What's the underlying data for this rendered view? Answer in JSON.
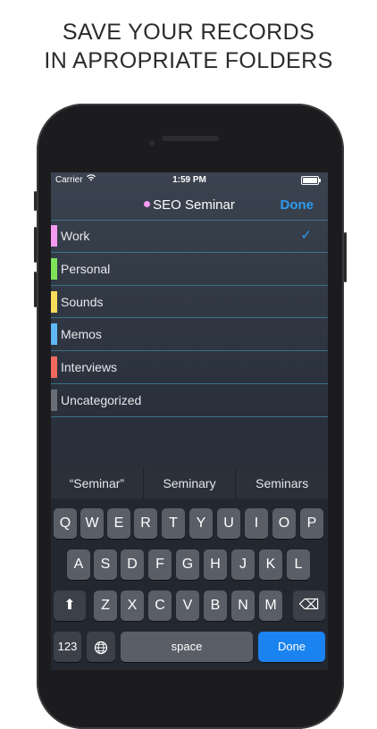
{
  "headline": {
    "line1": "SAVE YOUR RECORDS",
    "line2": "IN APROPRIATE FOLDERS"
  },
  "status_bar": {
    "carrier": "Carrier",
    "time": "1:59 PM"
  },
  "navbar": {
    "title": "SEO Seminar",
    "done_label": "Done",
    "dot_color": "#f59bf0"
  },
  "folders": [
    {
      "name": "Work",
      "color": "#f59bf0",
      "selected": true
    },
    {
      "name": "Personal",
      "color": "#7fe35a",
      "selected": false
    },
    {
      "name": "Sounds",
      "color": "#f7dd5a",
      "selected": false
    },
    {
      "name": "Memos",
      "color": "#5fb9f4",
      "selected": false
    },
    {
      "name": "Interviews",
      "color": "#f06a5e",
      "selected": false
    },
    {
      "name": "Uncategorized",
      "color": "#6a6e76",
      "selected": false
    }
  ],
  "checkmark": "✓",
  "suggestions": [
    "“Seminar”",
    "Seminary",
    "Seminars"
  ],
  "keyboard": {
    "row1": [
      "Q",
      "W",
      "E",
      "R",
      "T",
      "Y",
      "U",
      "I",
      "O",
      "P"
    ],
    "row2": [
      "A",
      "S",
      "D",
      "F",
      "G",
      "H",
      "J",
      "K",
      "L"
    ],
    "row3": [
      "Z",
      "X",
      "C",
      "V",
      "B",
      "N",
      "M"
    ],
    "shift_icon": "⬆",
    "delete_icon": "⌫",
    "numbers_label": "123",
    "globe_icon": "🌐",
    "space_label": "space",
    "done_label": "Done"
  }
}
